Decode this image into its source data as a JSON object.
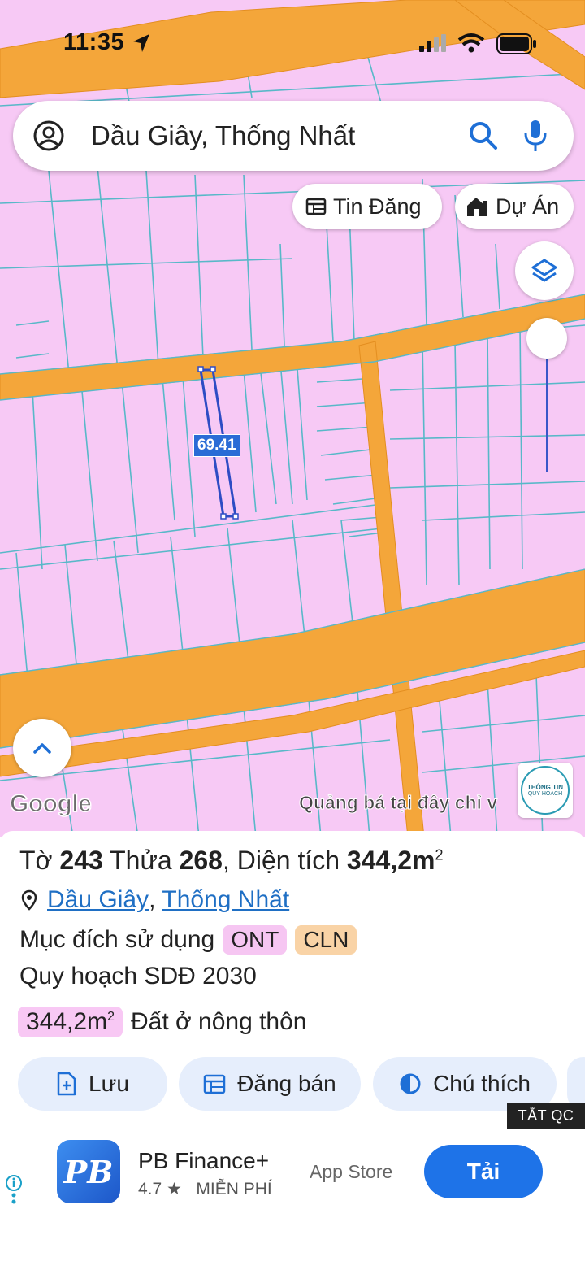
{
  "status_bar": {
    "time": "11:35"
  },
  "search": {
    "query": "Dầu Giây, Thống Nhất",
    "icons": [
      "avatar-icon",
      "search-icon",
      "mic-icon"
    ]
  },
  "chips": {
    "tin_dang": "Tin Đăng",
    "du_an": "Dự Án"
  },
  "map": {
    "measure_label": "69.41",
    "google_logo": "Google",
    "ad_text": "Quảng bá tại đây chỉ v",
    "badge_line1": "THÔNG TIN",
    "badge_line2": "QUY HOẠCH",
    "colors": {
      "land_residential": "#f7c9f5",
      "road": "#f4a63a",
      "parcel_line": "#58b8c8",
      "measure": "#3a57c8"
    }
  },
  "parcel": {
    "to_label": "Tờ",
    "to_value": "243",
    "thua_label": "Thửa",
    "thua_value": "268",
    "area_label": "Diện tích",
    "area_value": "344,2m",
    "area_sup": "2",
    "location_district": "Dầu Giây",
    "location_sep": ",",
    "location_province": "Thống Nhất",
    "purpose_label": "Mục đích sử dụng",
    "purpose_tags": [
      "ONT",
      "CLN"
    ],
    "plan_label": "Quy hoạch SDĐ 2030",
    "plan_area": "344,2m",
    "plan_area_sup": "2",
    "plan_type": "Đất ở nông thôn"
  },
  "actions": {
    "save": "Lưu",
    "post_sale": "Đăng bán",
    "legend": "Chú thích"
  },
  "ad": {
    "close_label": "TẮT QC",
    "app_icon_text": "PB",
    "app_name": "PB Finance+",
    "rating": "4.7 ★",
    "price": "MIỄN PHÍ",
    "store": "App Store",
    "install": "Tải"
  }
}
